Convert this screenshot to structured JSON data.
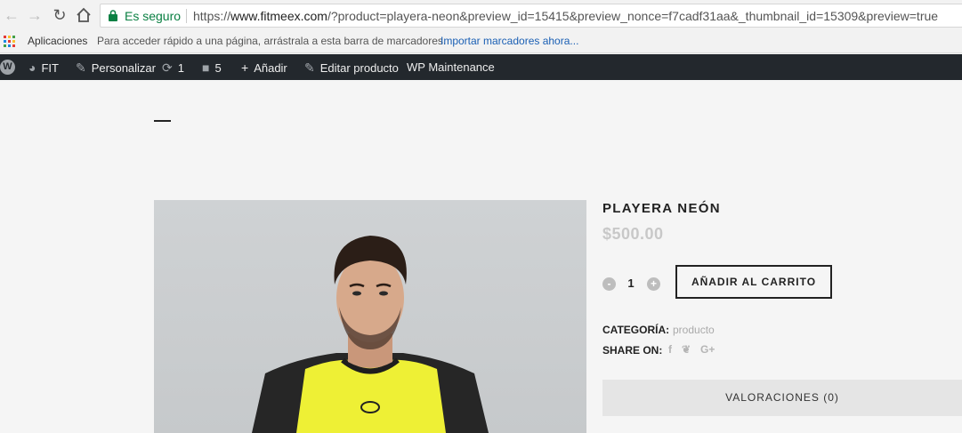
{
  "browser": {
    "secure_label": "Es seguro",
    "url_scheme": "https://",
    "url_host": "www.fitmeex.com",
    "url_path": "/?product=playera-neon&preview_id=15415&preview_nonce=f7cadf31aa&_thumbnail_id=15309&preview=true",
    "secure_color": "#0b8043"
  },
  "bookmarks": {
    "apps_label": "Aplicaciones",
    "hint": "Para acceder rápido a una página, arrástrala a esta barra de marcadores.",
    "import_link": "Importar marcadores ahora..."
  },
  "wp_admin": {
    "site_name": "FIT",
    "customize": "Personalizar",
    "updates_count": "1",
    "comments_count": "5",
    "add_new": "Añadir",
    "edit_product": "Editar producto",
    "maintenance": "WP Maintenance",
    "bar_color": "#23282d"
  },
  "product": {
    "title": "PLAYERA NEÓN",
    "price": "$500.00",
    "quantity": "1",
    "qty_minus": "-",
    "qty_plus": "+",
    "add_to_cart": "AÑADIR AL CARRITO",
    "category_label": "CATEGORÍA:",
    "category_value": "producto",
    "share_label": "SHARE ON:",
    "share_icons": [
      "facebook-icon",
      "twitter-icon",
      "google-plus-icon"
    ],
    "reviews_tab": "VALORACIONES (0)",
    "image_subject": "model-in-neon-yellow-shirt"
  }
}
